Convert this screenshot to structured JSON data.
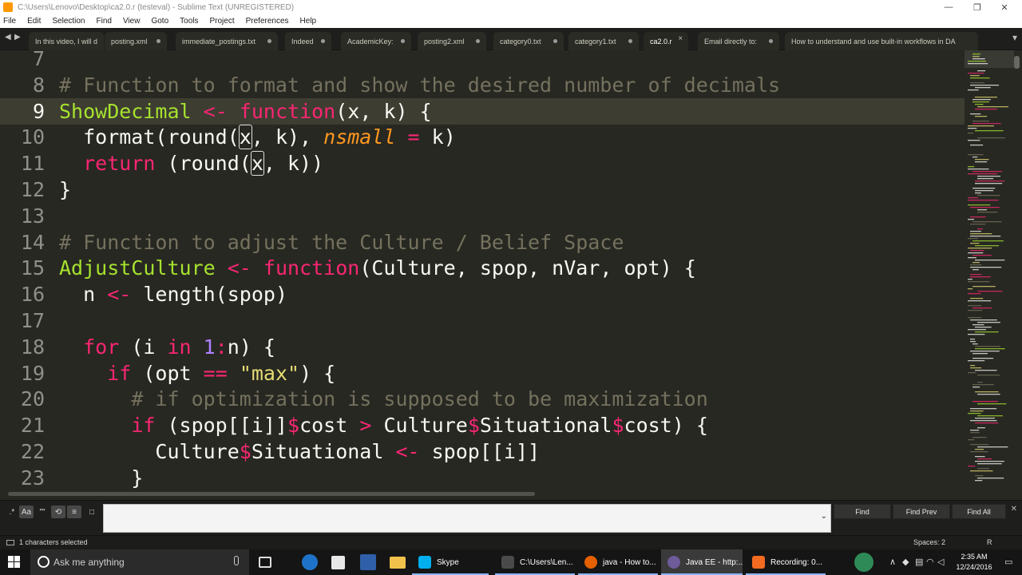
{
  "window": {
    "title": "C:\\Users\\Lenovo\\Desktop\\ca2.0.r (testeval) - Sublime Text (UNREGISTERED)",
    "controls": [
      "—",
      "❐",
      "✕"
    ]
  },
  "menu": [
    "File",
    "Edit",
    "Selection",
    "Find",
    "View",
    "Goto",
    "Tools",
    "Project",
    "Preferences",
    "Help"
  ],
  "tabs": [
    {
      "label": "In this video, I will d",
      "active": false
    },
    {
      "label": "posting.xml",
      "active": false
    },
    {
      "label": "immediate_postings.txt",
      "active": false
    },
    {
      "label": "Indeed",
      "active": false
    },
    {
      "label": "AcademicKey:",
      "active": false
    },
    {
      "label": "posting2.xml",
      "active": false
    },
    {
      "label": "category0.txt",
      "active": false
    },
    {
      "label": "category1.txt",
      "active": false
    },
    {
      "label": "ca2.0.r",
      "active": true
    },
    {
      "label": "Email directly to:",
      "active": false
    },
    {
      "label": "How to understand and use built-in workflows in DA",
      "active": false
    }
  ],
  "tab_nav": {
    "prev": "◀",
    "next": "▶",
    "more": "▾"
  },
  "editor": {
    "line_numbers": [
      "7",
      "8",
      "9",
      "10",
      "11",
      "12",
      "13",
      "14",
      "15",
      "16",
      "17",
      "18",
      "19",
      "20",
      "21",
      "22",
      "23"
    ],
    "current_line": "9",
    "lines": [
      [],
      [
        {
          "t": "# Function to format and show the desired number of decimals",
          "c": "cm"
        }
      ],
      [
        {
          "t": "ShowDecimal",
          "c": "fn"
        },
        {
          "t": " ",
          "c": ""
        },
        {
          "t": "<-",
          "c": "kw"
        },
        {
          "t": " ",
          "c": ""
        },
        {
          "t": "function",
          "c": "kw"
        },
        {
          "t": "(x, k) {",
          "c": ""
        }
      ],
      [
        {
          "t": "  format(round(",
          "c": ""
        },
        {
          "t": "x",
          "c": "sel"
        },
        {
          "t": ", k), ",
          "c": ""
        },
        {
          "t": "nsmall",
          "c": "arg"
        },
        {
          "t": " ",
          "c": ""
        },
        {
          "t": "=",
          "c": "kw"
        },
        {
          "t": " k)",
          "c": ""
        }
      ],
      [
        {
          "t": "  ",
          "c": ""
        },
        {
          "t": "return",
          "c": "kw"
        },
        {
          "t": " (round(",
          "c": ""
        },
        {
          "t": "x",
          "c": "sel"
        },
        {
          "t": ", k))",
          "c": ""
        }
      ],
      [
        {
          "t": "}",
          "c": ""
        }
      ],
      [],
      [
        {
          "t": "# Function to adjust the Culture / Belief Space",
          "c": "cm"
        }
      ],
      [
        {
          "t": "AdjustCulture",
          "c": "fn"
        },
        {
          "t": " ",
          "c": ""
        },
        {
          "t": "<-",
          "c": "kw"
        },
        {
          "t": " ",
          "c": ""
        },
        {
          "t": "function",
          "c": "kw"
        },
        {
          "t": "(Culture, spop, nVar, opt) {",
          "c": ""
        }
      ],
      [
        {
          "t": "  n ",
          "c": ""
        },
        {
          "t": "<-",
          "c": "kw"
        },
        {
          "t": " length(spop)",
          "c": ""
        }
      ],
      [],
      [
        {
          "t": "  ",
          "c": ""
        },
        {
          "t": "for",
          "c": "kw"
        },
        {
          "t": " (i ",
          "c": ""
        },
        {
          "t": "in",
          "c": "kw"
        },
        {
          "t": " ",
          "c": ""
        },
        {
          "t": "1",
          "c": "num"
        },
        {
          "t": ":",
          "c": "kw"
        },
        {
          "t": "n) {",
          "c": ""
        }
      ],
      [
        {
          "t": "    ",
          "c": ""
        },
        {
          "t": "if",
          "c": "kw"
        },
        {
          "t": " (opt ",
          "c": ""
        },
        {
          "t": "==",
          "c": "kw"
        },
        {
          "t": " ",
          "c": ""
        },
        {
          "t": "\"max\"",
          "c": "str"
        },
        {
          "t": ") {",
          "c": ""
        }
      ],
      [
        {
          "t": "      ",
          "c": ""
        },
        {
          "t": "# if optimization is supposed to be maximization",
          "c": "cm"
        }
      ],
      [
        {
          "t": "      ",
          "c": ""
        },
        {
          "t": "if",
          "c": "kw"
        },
        {
          "t": " (spop[[i]]",
          "c": ""
        },
        {
          "t": "$",
          "c": "kw"
        },
        {
          "t": "cost ",
          "c": ""
        },
        {
          "t": ">",
          "c": "kw"
        },
        {
          "t": " Culture",
          "c": ""
        },
        {
          "t": "$",
          "c": "kw"
        },
        {
          "t": "Situational",
          "c": ""
        },
        {
          "t": "$",
          "c": "kw"
        },
        {
          "t": "cost) {",
          "c": ""
        }
      ],
      [
        {
          "t": "        Culture",
          "c": ""
        },
        {
          "t": "$",
          "c": "kw"
        },
        {
          "t": "Situational ",
          "c": ""
        },
        {
          "t": "<-",
          "c": "kw"
        },
        {
          "t": " spop[[i]]",
          "c": ""
        }
      ],
      [
        {
          "t": "      }",
          "c": ""
        }
      ]
    ]
  },
  "find_panel": {
    "options": [
      "regex-icon",
      "case-icon",
      "whole-word-icon",
      "wrap-icon",
      "in-selection-icon",
      "highlight-icon"
    ],
    "option_glyphs": [
      ".*",
      "Aa",
      "\"\"",
      "⟲",
      "≡",
      "□"
    ],
    "value": "",
    "dropdown": "⌄",
    "buttons": [
      "Find",
      "Find Prev",
      "Find All"
    ],
    "close": "✕"
  },
  "statusbar": {
    "left": "1 characters selected",
    "spaces": "Spaces: 2",
    "syntax": "R"
  },
  "taskbar": {
    "search_placeholder": "Ask me anything",
    "tasks": [
      {
        "label": "Skype",
        "color": "#00aff0"
      },
      {
        "label": "C:\\Users\\Len...",
        "color": "#4a4a4a"
      },
      {
        "label": "java - How to...",
        "color": "#e66000"
      },
      {
        "label": "Java EE - http:...",
        "color": "#6d5b9a"
      },
      {
        "label": "Recording: 0...",
        "color": "#f26b21"
      }
    ],
    "time": "2:35 AM",
    "date": "12/24/2016"
  },
  "colors": {
    "background": "#272822",
    "comment": "#75715e",
    "keyword": "#f92672",
    "function": "#a6e22e",
    "string": "#e6db74",
    "number": "#ae81ff",
    "argument": "#fd971f"
  }
}
